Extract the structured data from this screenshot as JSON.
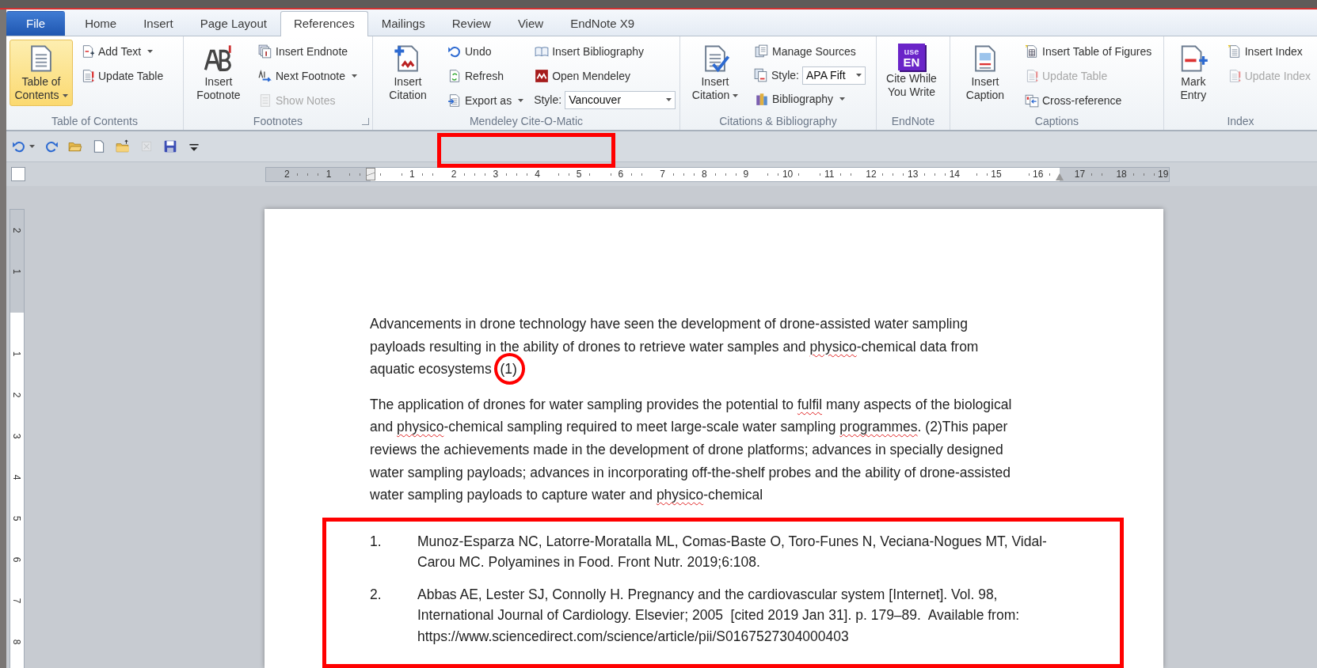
{
  "tabs": [
    {
      "label": "File",
      "kind": "file",
      "selected": false
    },
    {
      "label": "Home",
      "kind": "tab",
      "selected": false
    },
    {
      "label": "Insert",
      "kind": "tab",
      "selected": false
    },
    {
      "label": "Page Layout",
      "kind": "tab",
      "selected": false
    },
    {
      "label": "References",
      "kind": "tab",
      "selected": true
    },
    {
      "label": "Mailings",
      "kind": "tab",
      "selected": false
    },
    {
      "label": "Review",
      "kind": "tab",
      "selected": false
    },
    {
      "label": "View",
      "kind": "tab",
      "selected": false
    },
    {
      "label": "EndNote X9",
      "kind": "tab",
      "selected": false
    }
  ],
  "ribbon": {
    "groups": [
      {
        "title": "Table of Contents",
        "launcher": false,
        "columns": [
          [
            {
              "kind": "large",
              "label": "Table of Contents",
              "dropdown": true,
              "highlighted": true,
              "disabled": false
            }
          ],
          [
            {
              "kind": "small",
              "label": "Add Text",
              "dropdown": true,
              "highlighted": false,
              "disabled": false
            },
            {
              "kind": "small",
              "label": "Update Table",
              "dropdown": false,
              "highlighted": false,
              "disabled": false
            }
          ]
        ]
      },
      {
        "title": "Footnotes",
        "launcher": true,
        "columns": [
          [
            {
              "kind": "large",
              "label": "Insert Footnote",
              "dropdown": false,
              "highlighted": false,
              "disabled": false
            }
          ],
          [
            {
              "kind": "small",
              "label": "Insert Endnote",
              "dropdown": false,
              "highlighted": false,
              "disabled": false
            },
            {
              "kind": "small",
              "label": "Next Footnote",
              "dropdown": true,
              "highlighted": false,
              "disabled": false
            },
            {
              "kind": "small",
              "label": "Show Notes",
              "dropdown": false,
              "highlighted": false,
              "disabled": true
            }
          ]
        ]
      },
      {
        "title": "Mendeley Cite-O-Matic",
        "launcher": false,
        "columns": [
          [
            {
              "kind": "large",
              "label": "Insert Citation",
              "dropdown": false,
              "highlighted": false,
              "disabled": false
            }
          ],
          [
            {
              "kind": "small",
              "label": "Undo",
              "dropdown": false,
              "highlighted": false,
              "disabled": false
            },
            {
              "kind": "small",
              "label": "Refresh",
              "dropdown": false,
              "highlighted": false,
              "disabled": false
            },
            {
              "kind": "small",
              "label": "Export as",
              "dropdown": true,
              "highlighted": false,
              "disabled": false
            }
          ],
          [
            {
              "kind": "small",
              "label": "Insert Bibliography",
              "dropdown": false,
              "highlighted": false,
              "disabled": false
            },
            {
              "kind": "small",
              "label": "Open Mendeley",
              "dropdown": false,
              "highlighted": false,
              "disabled": false
            },
            {
              "kind": "combo",
              "label": "Style:",
              "value": "Vancouver",
              "wide": true,
              "disabled": false
            }
          ]
        ]
      },
      {
        "title": "Citations & Bibliography",
        "launcher": false,
        "columns": [
          [
            {
              "kind": "large",
              "label": "Insert Citation",
              "dropdown": true,
              "highlighted": false,
              "disabled": false
            }
          ],
          [
            {
              "kind": "small",
              "label": "Manage Sources",
              "dropdown": false,
              "highlighted": false,
              "disabled": false
            },
            {
              "kind": "combo",
              "label": "Style:",
              "value": "APA Fift",
              "wide": false,
              "disabled": false
            },
            {
              "kind": "small",
              "label": "Bibliography",
              "dropdown": true,
              "highlighted": false,
              "disabled": false
            }
          ]
        ]
      },
      {
        "title": "EndNote",
        "launcher": false,
        "columns": [
          [
            {
              "kind": "large",
              "label": "Cite While You Write",
              "icon_lines": [
                "use",
                "EN"
              ],
              "dropdown": false,
              "highlighted": false,
              "disabled": false
            }
          ]
        ]
      },
      {
        "title": "Captions",
        "launcher": false,
        "columns": [
          [
            {
              "kind": "large",
              "label": "Insert Caption",
              "dropdown": false,
              "highlighted": false,
              "disabled": false
            }
          ],
          [
            {
              "kind": "small",
              "label": "Insert Table of Figures",
              "dropdown": false,
              "highlighted": false,
              "disabled": false
            },
            {
              "kind": "small",
              "label": "Update Table",
              "dropdown": false,
              "highlighted": false,
              "disabled": true
            },
            {
              "kind": "small",
              "label": "Cross-reference",
              "dropdown": false,
              "highlighted": false,
              "disabled": false
            }
          ]
        ]
      },
      {
        "title": "Index",
        "launcher": false,
        "columns": [
          [
            {
              "kind": "large",
              "label": "Mark Entry",
              "dropdown": false,
              "highlighted": false,
              "disabled": false
            }
          ],
          [
            {
              "kind": "small",
              "label": "Insert Index",
              "dropdown": false,
              "highlighted": false,
              "disabled": false
            },
            {
              "kind": "small",
              "label": "Update Index",
              "dropdown": false,
              "highlighted": false,
              "disabled": true
            }
          ]
        ]
      }
    ]
  },
  "quick_access": {
    "marked": true,
    "items": [
      {
        "dropdown": true,
        "disabled": false
      },
      {
        "dropdown": false,
        "disabled": false
      },
      {
        "dropdown": false,
        "disabled": false
      },
      {
        "dropdown": false,
        "disabled": false
      },
      {
        "dropdown": false,
        "disabled": false
      },
      {
        "dropdown": false,
        "disabled": true
      },
      {
        "dropdown": false,
        "disabled": false
      },
      {
        "dropdown": false,
        "disabled": false
      }
    ]
  },
  "horizontal_ruler": {
    "left_labels": [
      "2",
      "1"
    ],
    "right_labels": [
      "1",
      "2",
      "3",
      "4",
      "5",
      "6",
      "7",
      "8",
      "9",
      "10",
      "11",
      "12",
      "13",
      "14",
      "15",
      "16",
      "17",
      "18",
      "19"
    ]
  },
  "vertical_ruler": {
    "top_labels": [
      "2",
      "1"
    ],
    "bottom_labels": [
      "1",
      "2",
      "3",
      "4",
      "5",
      "6",
      "7",
      "8"
    ]
  },
  "document": {
    "paragraphs": [
      {
        "segments": [
          {
            "text": "Advancements in drone technology have seen the development of drone-assisted water sampling payloads resulting in the ability of drones to retrieve water samples and ",
            "misspelled": false,
            "circled": false
          },
          {
            "text": "physico",
            "misspelled": true,
            "circled": false
          },
          {
            "text": "-chemical data from aquatic ecosystems ",
            "misspelled": false,
            "circled": false
          },
          {
            "text": "(1)",
            "misspelled": false,
            "circled": true
          }
        ]
      },
      {
        "segments": [
          {
            "text": "The application of drones for water sampling provides the potential to ",
            "misspelled": false,
            "circled": false
          },
          {
            "text": "fulfil",
            "misspelled": true,
            "circled": false
          },
          {
            "text": " many aspects of the biological and ",
            "misspelled": false,
            "circled": false
          },
          {
            "text": "physico",
            "misspelled": true,
            "circled": false
          },
          {
            "text": "-chemical sampling required to meet large-scale water sampling ",
            "misspelled": false,
            "circled": false
          },
          {
            "text": "programmes",
            "misspelled": true,
            "circled": false
          },
          {
            "text": ". (2)This paper reviews the achievements made in the development of drone platforms; advances in specially designed water sampling payloads; advances in incorporating off-the-shelf probes and the ability of drone-assisted water sampling payloads to capture water and ",
            "misspelled": false,
            "circled": false
          },
          {
            "text": "physico",
            "misspelled": true,
            "circled": false
          },
          {
            "text": "-chemical",
            "misspelled": false,
            "circled": false
          }
        ]
      }
    ],
    "bibliography": {
      "boxed": true,
      "items": [
        {
          "number": "1.",
          "text": "Munoz-Esparza NC, Latorre-Moratalla ML, Comas-Baste O, Toro-Funes N, Veciana-Nogues MT, Vidal-Carou MC. Polyamines in Food. Front Nutr. 2019;6:108."
        },
        {
          "number": "2.",
          "text": "Abbas AE, Lester SJ, Connolly H. Pregnancy and the cardiovascular system [Internet]. Vol. 98, International Journal of Cardiology. Elsevier; 2005  [cited 2019 Jan 31]. p. 179–89.  Available from: https://www.sciencedirect.com/science/article/pii/S0167527304000403"
        }
      ]
    }
  }
}
